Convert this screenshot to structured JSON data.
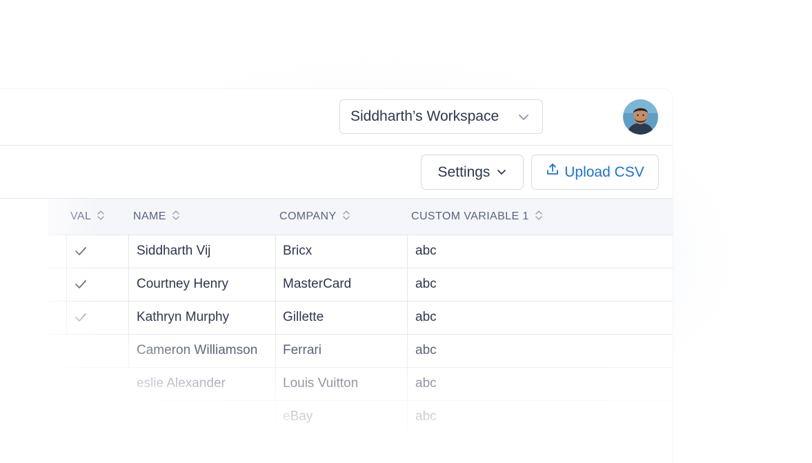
{
  "header": {
    "workspace_label": "Siddharth’s Workspace",
    "workspace_chevron_icon": "chevron-down-icon",
    "avatar_icon": "user-avatar-photo"
  },
  "toolbar": {
    "settings_label": "Settings",
    "upload_label": "Upload CSV",
    "upload_icon": "upload-icon"
  },
  "table": {
    "columns": [
      {
        "label": "VAL",
        "sort_icon": "sort-icon"
      },
      {
        "label": "NAME",
        "sort_icon": "sort-icon"
      },
      {
        "label": "COMPANY",
        "sort_icon": "sort-icon"
      },
      {
        "label": "CUSTOM VARIABLE 1",
        "sort_icon": "sort-icon"
      }
    ],
    "rows": [
      {
        "valid": true,
        "name": "Siddharth Vij",
        "company": "Bricx",
        "custom1": "abc"
      },
      {
        "valid": true,
        "name": "Courtney Henry",
        "company": "MasterCard",
        "custom1": "abc"
      },
      {
        "valid": true,
        "name": "Kathryn Murphy",
        "company": "Gillette",
        "custom1": "abc"
      },
      {
        "valid": false,
        "name": "Cameron Williamson",
        "company": "Ferrari",
        "custom1": "abc"
      },
      {
        "valid": false,
        "name": "eslie Alexander",
        "company": "Louis Vuitton",
        "custom1": "abc"
      },
      {
        "valid": false,
        "name": "",
        "company": "eBay",
        "custom1": "abc"
      }
    ]
  },
  "colors": {
    "text": "#2e3650",
    "header_text": "#5a6280",
    "accent": "#1d6fe0",
    "border": "#e3e6ee",
    "header_bg": "#f5f6f9"
  }
}
